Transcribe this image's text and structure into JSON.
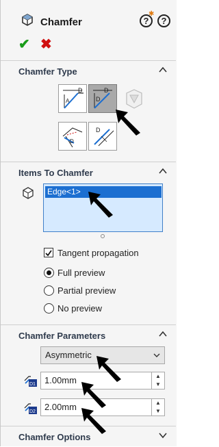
{
  "header": {
    "title": "Chamfer",
    "ok_symbol": "✔",
    "cancel_symbol": "✖",
    "help_label": "?"
  },
  "chamfer_type": {
    "title": "Chamfer Type",
    "buttons": [
      {
        "id": "distance-distance",
        "label": "D",
        "active": false
      },
      {
        "id": "angle-distance",
        "label": "D",
        "active": true
      },
      {
        "id": "vertex",
        "label": "D",
        "active": false
      },
      {
        "id": "offset-face",
        "label": "D",
        "active": false
      }
    ]
  },
  "items": {
    "title": "Items To Chamfer",
    "entries": [
      "Edge<1>"
    ],
    "tangent_label": "Tangent propagation",
    "tangent_checked": true,
    "preview_options": [
      {
        "label": "Full preview",
        "selected": true
      },
      {
        "label": "Partial preview",
        "selected": false
      },
      {
        "label": "No preview",
        "selected": false
      }
    ]
  },
  "parameters": {
    "title": "Chamfer Parameters",
    "method": "Asymmetric",
    "d1_label": "D1",
    "d1_value": "1.00mm",
    "d2_label": "D2",
    "d2_value": "2.00mm"
  },
  "options": {
    "title": "Chamfer Options"
  },
  "colors": {
    "ok": "#1a9c1a",
    "cancel": "#d01010",
    "selection": "#1c6fd1",
    "list_bg": "#d6eaff"
  }
}
